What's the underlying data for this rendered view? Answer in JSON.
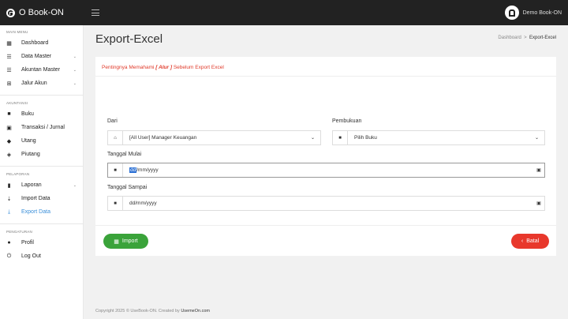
{
  "brand": {
    "name": "O Book-ON"
  },
  "user": {
    "name": "Demo Book-ON"
  },
  "sidebar": {
    "main_title": "MAIN MENU",
    "main_items": [
      {
        "label": "Dashboard",
        "icon": "dashboard-icon"
      },
      {
        "label": "Data Master",
        "icon": "list-icon"
      },
      {
        "label": "Akuntan Master",
        "icon": "list-icon"
      },
      {
        "label": "Jalur Akun",
        "icon": "grid-icon"
      }
    ],
    "akuntansi_title": "AKUNTANSI",
    "akuntansi_items": [
      {
        "label": "Buku",
        "icon": "book-icon"
      },
      {
        "label": "Transaksi / Jurnal",
        "icon": "journal-icon"
      },
      {
        "label": "Utang",
        "icon": "tag-icon"
      },
      {
        "label": "Piutang",
        "icon": "tags-icon"
      }
    ],
    "laporan_title": "PELAPORAN",
    "laporan_items": [
      {
        "label": "Laporan",
        "icon": "file-icon"
      },
      {
        "label": "Import Data",
        "icon": "import-icon"
      },
      {
        "label": "Export Data",
        "icon": "export-icon"
      }
    ],
    "pengaturan_title": "PENGATURAN",
    "pengaturan_items": [
      {
        "label": "Profil",
        "icon": "user-icon"
      },
      {
        "label": "Log Out",
        "icon": "power-icon"
      }
    ],
    "caret": "⌄"
  },
  "page": {
    "title": "Export-Excel",
    "breadcrumb_home": "Dashboard",
    "breadcrumb_sep": ">",
    "breadcrumb_current": "Export-Excel"
  },
  "notice": {
    "prefix": "Pentingnya Memahami",
    "highlight": "[ Alur ]",
    "suffix": "Sebelum Export Excel"
  },
  "form": {
    "dari_label": "Dari",
    "dari_value": "[All User] Manager Keuangan",
    "pembukuan_label": "Pembukuan",
    "pembukuan_value": "Pilih Buku",
    "mulai_label": "Tanggal Mulai",
    "mulai_selected": "dd",
    "mulai_rest": "/mm/yyyy",
    "sampai_label": "Tanggal Sampai",
    "sampai_value": "dd/mm/yyyy"
  },
  "buttons": {
    "import_label": "Import",
    "batal_label": "Batal"
  },
  "footer": {
    "prefix": "Copyright 2025 © UseBook-ON. Created by",
    "author": "UsemeOn.com"
  },
  "colors": {
    "accent": "#3a8fd9",
    "danger": "#e8382c",
    "success": "#3aa33a",
    "notice": "#e03a2a",
    "topbar": "#222222"
  }
}
